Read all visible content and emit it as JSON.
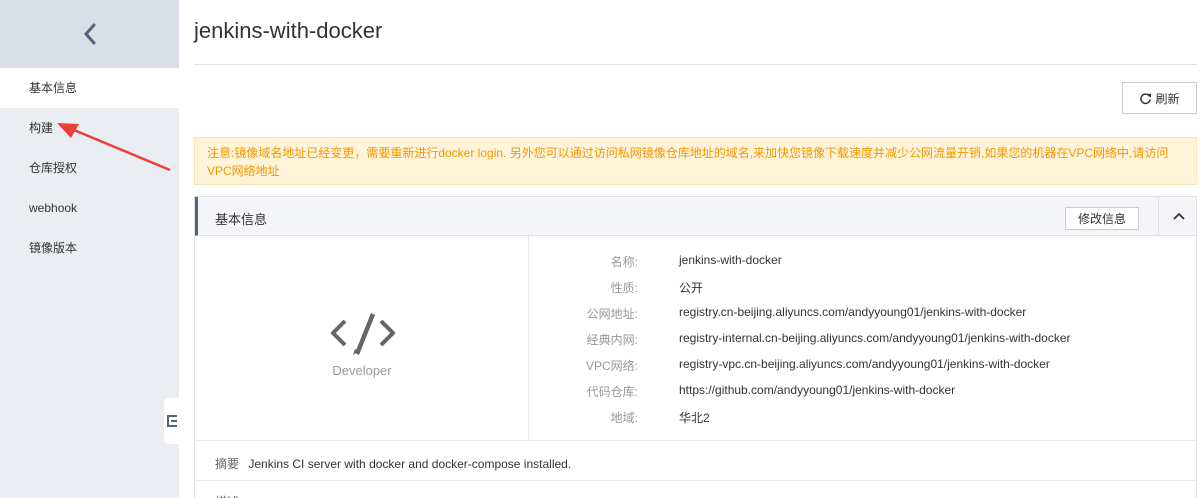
{
  "sidebar": {
    "items": [
      {
        "label": "基本信息"
      },
      {
        "label": "构建"
      },
      {
        "label": "仓库授权"
      },
      {
        "label": "webhook"
      },
      {
        "label": "镜像版本"
      }
    ]
  },
  "header": {
    "title": "jenkins-with-docker",
    "refresh_label": "刷新"
  },
  "notice": {
    "text": "注意:镜像域名地址已经变更，需要重新进行docker login. 另外您可以通过访问私网镜像仓库地址的域名,来加快您镜像下载速度并减少公网流量开销,如果您的机器在VPC网络中,请访问VPC网络地址"
  },
  "panel": {
    "title": "基本信息",
    "edit_label": "修改信息",
    "logo_text": "Developer",
    "fields": [
      {
        "label": "名称:",
        "value": "jenkins-with-docker"
      },
      {
        "label": "性质:",
        "value": "公开"
      },
      {
        "label": "公网地址:",
        "value": "registry.cn-beijing.aliyuncs.com/andyyoung01/jenkins-with-docker"
      },
      {
        "label": "经典内网:",
        "value": "registry-internal.cn-beijing.aliyuncs.com/andyyoung01/jenkins-with-docker"
      },
      {
        "label": "VPC网络:",
        "value": "registry-vpc.cn-beijing.aliyuncs.com/andyyoung01/jenkins-with-docker"
      },
      {
        "label": "代码仓库:",
        "value": "https://github.com/andyyoung01/jenkins-with-docker"
      },
      {
        "label": "地域:",
        "value": "华北2"
      }
    ],
    "summary_label": "摘要",
    "summary_value": "Jenkins CI server with docker and docker-compose installed.",
    "desc_label": "描述"
  },
  "colors": {
    "sidebar_bg": "#eaedf1",
    "notice_text": "#f39800",
    "notice_bg": "#fff3da",
    "annotation_arrow": "#e8413a"
  }
}
